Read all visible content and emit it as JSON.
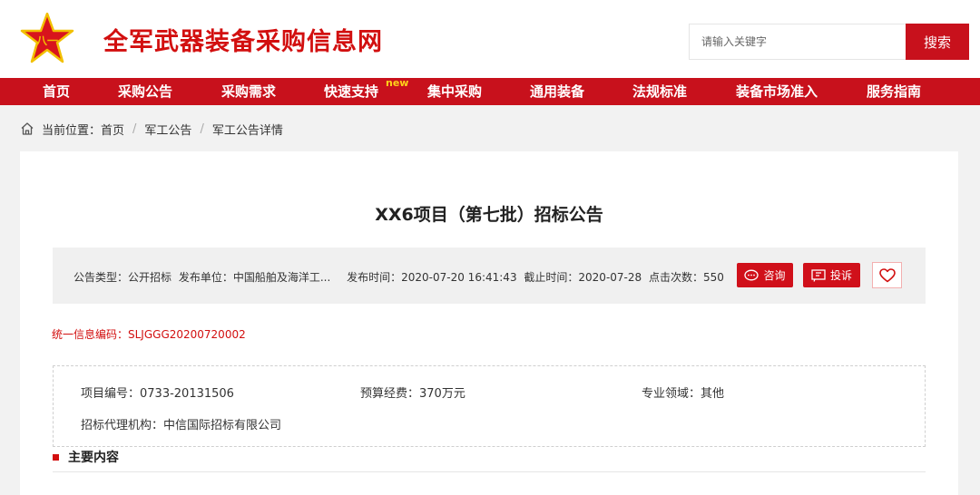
{
  "header": {
    "site_title": "全军武器装备采购信息网",
    "logo_text": "八一",
    "search_placeholder": "请输入关键字",
    "search_button": "搜索"
  },
  "nav": {
    "items": [
      {
        "label": "首页"
      },
      {
        "label": "采购公告"
      },
      {
        "label": "采购需求"
      },
      {
        "label": "快速支持",
        "badge": "new"
      },
      {
        "label": "集中采购"
      },
      {
        "label": "通用装备"
      },
      {
        "label": "法规标准"
      },
      {
        "label": "装备市场准入"
      },
      {
        "label": "服务指南"
      }
    ]
  },
  "breadcrumb": {
    "prefix": "当前位置：",
    "items": [
      "首页",
      "军工公告",
      "军工公告详情"
    ],
    "separator": "/"
  },
  "notice": {
    "title": "XX6项目（第七批）招标公告",
    "meta": {
      "type": "公告类型：公开招标",
      "publisher": "发布单位：中国船舶及海洋工...",
      "publish_time": "发布时间：2020-07-20 16:41:43",
      "deadline": "截止时间：2020-07-28",
      "clicks": "点击次数：550"
    },
    "buttons": {
      "consult": "咨询",
      "complain": "投诉"
    },
    "unified_code": "统一信息编码：SLJGGG20200720002",
    "info": {
      "project_no": "项目编号：0733-20131506",
      "budget": "预算经费：370万元",
      "field": "专业领域：其他",
      "agency": "招标代理机构：中信国际招标有限公司"
    },
    "section_title": "主要内容"
  },
  "colors": {
    "brand_red": "#c8111c",
    "new_badge": "#ffd21a"
  }
}
